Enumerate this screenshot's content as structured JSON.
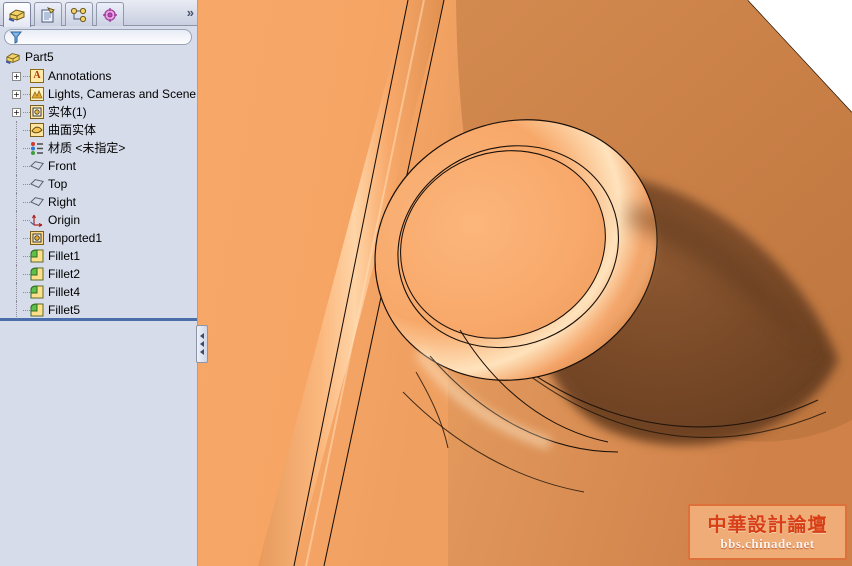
{
  "panel": {
    "tabs": [
      {
        "name": "feature-manager-tab",
        "icon": "part-block-icon",
        "active": true
      },
      {
        "name": "property-manager-tab",
        "icon": "clipboard-icon",
        "active": false
      },
      {
        "name": "configuration-manager-tab",
        "icon": "configuration-icon",
        "active": false
      },
      {
        "name": "display-manager-tab",
        "icon": "display-crosshair-icon",
        "active": false
      }
    ],
    "overflow_label": "»",
    "filter": {
      "placeholder": "",
      "value": "",
      "icon": "filter-funnel-icon"
    },
    "tree": [
      {
        "label": "Part5",
        "icon": "part-icon",
        "indent": 0,
        "expander": "none"
      },
      {
        "label": "Annotations",
        "icon": "annotations-icon",
        "indent": 1,
        "expander": "+"
      },
      {
        "label": "Lights, Cameras and Scene",
        "icon": "lights-icon",
        "indent": 1,
        "expander": "+"
      },
      {
        "label": "实体(1)",
        "icon": "solid-bodies-icon",
        "indent": 1,
        "expander": "+"
      },
      {
        "label": "曲面实体",
        "icon": "surface-bodies-icon",
        "indent": 1,
        "expander": "none"
      },
      {
        "label": "材质 <未指定>",
        "icon": "material-icon",
        "indent": 1,
        "expander": "none"
      },
      {
        "label": "Front",
        "icon": "plane-icon",
        "indent": 1,
        "expander": "none"
      },
      {
        "label": "Top",
        "icon": "plane-icon",
        "indent": 1,
        "expander": "none"
      },
      {
        "label": "Right",
        "icon": "plane-icon",
        "indent": 1,
        "expander": "none"
      },
      {
        "label": "Origin",
        "icon": "origin-icon",
        "indent": 1,
        "expander": "none"
      },
      {
        "label": "Imported1",
        "icon": "imported-icon",
        "indent": 1,
        "expander": "none"
      },
      {
        "label": "Fillet1",
        "icon": "fillet-icon",
        "indent": 1,
        "expander": "none"
      },
      {
        "label": "Fillet2",
        "icon": "fillet-icon",
        "indent": 1,
        "expander": "none"
      },
      {
        "label": "Fillet4",
        "icon": "fillet-icon",
        "indent": 1,
        "expander": "none"
      },
      {
        "label": "Fillet5",
        "icon": "fillet-icon",
        "indent": 1,
        "expander": "none"
      }
    ],
    "splitter": {
      "name": "panel-splitter-handle",
      "arrows": 3
    }
  },
  "viewport": {
    "background": "#ffffff",
    "model": {
      "name": "shaded-cad-part",
      "base_color": "#f6a565",
      "shadow_color": "#7b4a26",
      "mid_color": "#d0854b",
      "highlight_color": "#fde8c8",
      "edge_color": "#1a1008",
      "description": "Orange shaded solid model with a filleted circular boss, a diagonal rib and a deep shadowed pocket"
    }
  },
  "watermark": {
    "name": "forum-watermark",
    "title": "中華設計論壇",
    "url": "bbs.chinade.net",
    "frame_color": "#e0703a",
    "text_color": "#d93a12"
  }
}
